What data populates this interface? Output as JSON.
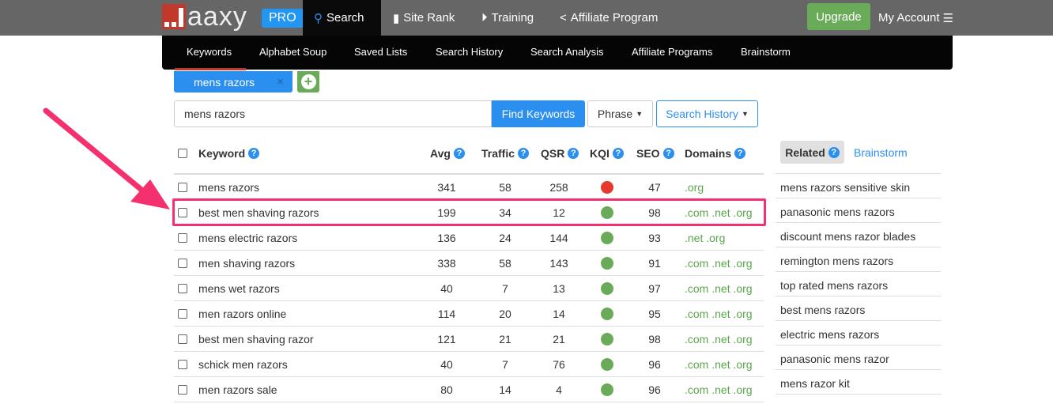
{
  "brand": {
    "logo_text": "aaxy",
    "badge": "PRO"
  },
  "topnav": [
    {
      "label": "Search",
      "icon": "search-icon"
    },
    {
      "label": "Site Rank",
      "icon": "bar-chart-icon"
    },
    {
      "label": "Training",
      "icon": "play-circle-icon"
    },
    {
      "label": "Affiliate Program",
      "icon": "share-icon"
    }
  ],
  "upgrade_label": "Upgrade",
  "account_label": "My Account",
  "subnav": [
    "Keywords",
    "Alphabet Soup",
    "Saved Lists",
    "Search History",
    "Search Analysis",
    "Affiliate Programs",
    "Brainstorm"
  ],
  "search_tab": {
    "label": "mens razors",
    "close": "×"
  },
  "search": {
    "value": "mens razors",
    "find_label": "Find Keywords",
    "phrase_label": "Phrase",
    "history_label": "Search History"
  },
  "table": {
    "headers": [
      "Keyword",
      "Avg",
      "Traffic",
      "QSR",
      "KQI",
      "SEO",
      "Domains"
    ],
    "rows": [
      {
        "keyword": "mens razors",
        "avg": "341",
        "traffic": "58",
        "qsr": "258",
        "kqi": "#e53a2b",
        "seo": "47",
        "domains": ".org"
      },
      {
        "keyword": "best men shaving razors",
        "avg": "199",
        "traffic": "34",
        "qsr": "12",
        "kqi": "#6aab5a",
        "seo": "98",
        "domains": ".com .net .org"
      },
      {
        "keyword": "mens electric razors",
        "avg": "136",
        "traffic": "24",
        "qsr": "144",
        "kqi": "#6aab5a",
        "seo": "93",
        "domains": ".net .org"
      },
      {
        "keyword": "men shaving razors",
        "avg": "338",
        "traffic": "58",
        "qsr": "143",
        "kqi": "#6aab5a",
        "seo": "91",
        "domains": ".com .net .org"
      },
      {
        "keyword": "mens wet razors",
        "avg": "40",
        "traffic": "7",
        "qsr": "13",
        "kqi": "#6aab5a",
        "seo": "97",
        "domains": ".com .net .org"
      },
      {
        "keyword": "men razors online",
        "avg": "114",
        "traffic": "20",
        "qsr": "14",
        "kqi": "#6aab5a",
        "seo": "95",
        "domains": ".com .net .org"
      },
      {
        "keyword": "best men shaving razor",
        "avg": "121",
        "traffic": "21",
        "qsr": "21",
        "kqi": "#6aab5a",
        "seo": "98",
        "domains": ".com .net .org"
      },
      {
        "keyword": "schick men razors",
        "avg": "40",
        "traffic": "7",
        "qsr": "76",
        "kqi": "#6aab5a",
        "seo": "96",
        "domains": ".com .net .org"
      },
      {
        "keyword": "men razors sale",
        "avg": "80",
        "traffic": "14",
        "qsr": "4",
        "kqi": "#6aab5a",
        "seo": "96",
        "domains": ".com .net .org"
      }
    ]
  },
  "related": {
    "tab_label": "Related",
    "brainstorm_label": "Brainstorm",
    "items": [
      "mens razors sensitive skin",
      "panasonic mens razors",
      "discount mens razor blades",
      "remington mens razors",
      "top rated mens razors",
      "best mens razors",
      "electric mens razors",
      "panasonic mens razor",
      "mens razor kit"
    ]
  },
  "annotation_color": "#f5306f"
}
